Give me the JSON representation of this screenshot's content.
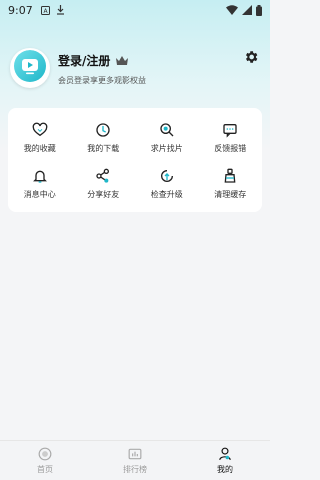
{
  "status_bar": {
    "time": "9:07",
    "icons": [
      "a-box-icon",
      "download-icon",
      "wifi-icon",
      "signal-icon",
      "battery-icon"
    ]
  },
  "profile": {
    "title": "登录/注册",
    "subtitle": "会员登录享更多观影权益",
    "crown_icon": "crown-icon",
    "avatar_icon": "tv-logo-icon"
  },
  "settings_icon": "gear-icon",
  "colors": {
    "accent": "#1fb7c9",
    "header_top": "#c6eef2",
    "page_bg": "#f4f5f7",
    "card_bg": "#ffffff",
    "nav_inactive": "#9a9a9a",
    "nav_active": "#111111"
  },
  "grid": {
    "items": [
      {
        "label": "我的收藏",
        "icon": "heart-icon"
      },
      {
        "label": "我的下载",
        "icon": "download-circle-icon"
      },
      {
        "label": "求片找片",
        "icon": "search-film-icon"
      },
      {
        "label": "反馈报错",
        "icon": "feedback-icon"
      },
      {
        "label": "消息中心",
        "icon": "bell-icon"
      },
      {
        "label": "分享好友",
        "icon": "share-icon"
      },
      {
        "label": "检查升级",
        "icon": "upgrade-icon"
      },
      {
        "label": "清理缓存",
        "icon": "clean-icon"
      }
    ]
  },
  "bottom_nav": {
    "items": [
      {
        "label": "首页",
        "icon": "home-icon",
        "active": false
      },
      {
        "label": "排行榜",
        "icon": "ranking-icon",
        "active": false
      },
      {
        "label": "我的",
        "icon": "profile-icon",
        "active": true
      }
    ]
  }
}
